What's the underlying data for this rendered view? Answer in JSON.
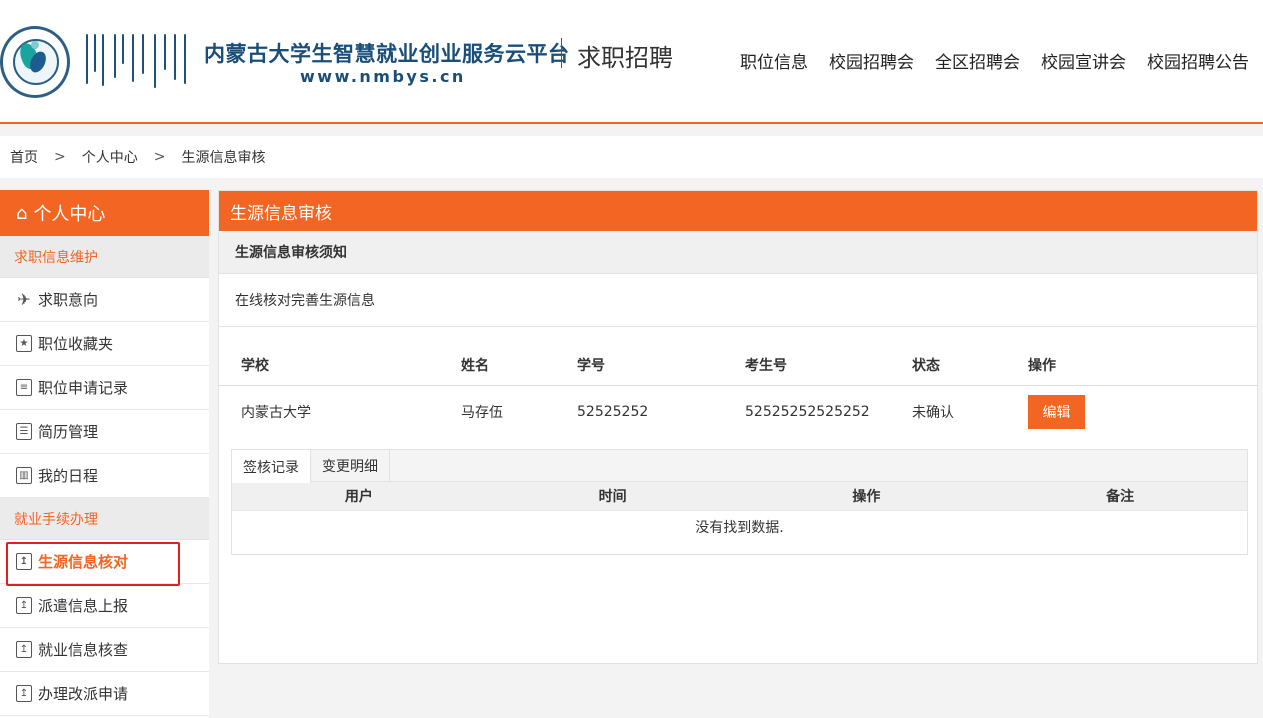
{
  "header": {
    "site_title": "内蒙古大学生智慧就业创业服务云平台",
    "site_url": "www.nmbys.cn",
    "section_title": "求职招聘",
    "nav": [
      "职位信息",
      "校园招聘会",
      "全区招聘会",
      "校园宣讲会",
      "校园招聘公告"
    ]
  },
  "breadcrumb": {
    "items": [
      "首页",
      "个人中心",
      "生源信息审核"
    ],
    "separator": ">"
  },
  "sidebar": {
    "title": "个人中心",
    "groups": [
      {
        "label": "求职信息维护",
        "items": [
          {
            "label": "求职意向",
            "icon": "paper-plane-icon"
          },
          {
            "label": "职位收藏夹",
            "icon": "folder-icon"
          },
          {
            "label": "职位申请记录",
            "icon": "calendar-icon"
          },
          {
            "label": "简历管理",
            "icon": "resume-icon"
          },
          {
            "label": "我的日程",
            "icon": "schedule-icon"
          }
        ]
      },
      {
        "label": "就业手续办理",
        "items": [
          {
            "label": "生源信息核对",
            "icon": "upload-doc-icon",
            "active": true
          },
          {
            "label": "派遣信息上报",
            "icon": "upload-doc-icon"
          },
          {
            "label": "就业信息核查",
            "icon": "upload-doc-icon"
          },
          {
            "label": "办理改派申请",
            "icon": "upload-doc-icon"
          }
        ]
      }
    ]
  },
  "main": {
    "panel_title": "生源信息审核",
    "notice_title": "生源信息审核须知",
    "notice_text": "在线核对完善生源信息",
    "table": {
      "columns": [
        "学校",
        "姓名",
        "学号",
        "考生号",
        "状态",
        "操作"
      ],
      "rows": [
        {
          "school": "内蒙古大学",
          "name": "马存伍",
          "student_id": "52525252",
          "exam_id": "52525252525252",
          "status": "未确认",
          "action": "编辑"
        }
      ]
    },
    "subtabs": {
      "tabs": [
        "签核记录",
        "变更明细"
      ],
      "active": "签核记录",
      "columns": [
        "用户",
        "时间",
        "操作",
        "备注"
      ],
      "empty_text": "没有找到数据."
    }
  },
  "colors": {
    "accent": "#f26522",
    "brand_blue": "#1a4e79",
    "highlight_border": "#e02020"
  }
}
